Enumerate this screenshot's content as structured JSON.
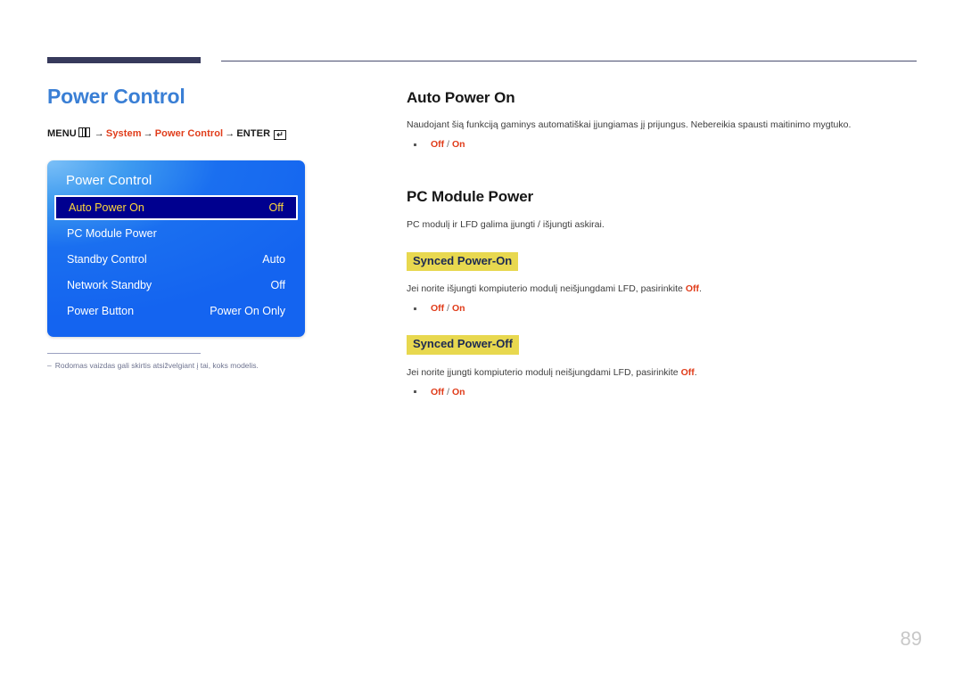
{
  "document": {
    "page_number": "89"
  },
  "left": {
    "title": "Power Control",
    "menu_path": {
      "menu_label": "MENU",
      "menu_icon": "menu-grid-icon",
      "arrow": "→",
      "step1": "System",
      "step2": "Power Control",
      "enter_label": "ENTER",
      "enter_icon": "↵"
    },
    "osd": {
      "title": "Power Control",
      "rows": [
        {
          "label": "Auto Power On",
          "value": "Off",
          "selected": true
        },
        {
          "label": "PC Module Power",
          "value": "",
          "selected": false
        },
        {
          "label": "Standby Control",
          "value": "Auto",
          "selected": false
        },
        {
          "label": "Network Standby",
          "value": "Off",
          "selected": false
        },
        {
          "label": "Power Button",
          "value": "Power On Only",
          "selected": false
        }
      ]
    },
    "footnote": {
      "dash": "–",
      "text": "Rodomas vaizdas gali skirtis atsižvelgiant į tai, koks modelis."
    }
  },
  "right": {
    "section1": {
      "heading": "Auto Power On",
      "description": "Naudojant šią funkciją gaminys automatiškai įjungiamas jį prijungus. Nebereikia spausti maitinimo mygtuko.",
      "option_off": "Off",
      "option_sep": "/",
      "option_on": "On"
    },
    "section2": {
      "heading": "PC Module Power",
      "description": "PC modulį ir LFD galima įjungti / išjungti askirai.",
      "sub1": {
        "heading": "Synced Power-On",
        "description_pre": "Jei norite išjungti kompiuterio modulį neišjungdami LFD, pasirinkite ",
        "description_accent": "Off",
        "description_post": ".",
        "option_off": "Off",
        "option_sep": "/",
        "option_on": "On"
      },
      "sub2": {
        "heading": "Synced Power-Off",
        "description_pre": "Jei norite įjungti kompiuterio modulį neišjungdami LFD, pasirinkite ",
        "description_accent": "Off",
        "description_post": ".",
        "option_off": "Off",
        "option_sep": "/",
        "option_on": "On"
      }
    }
  },
  "colors": {
    "page_title_blue": "#3a7fd5",
    "accent_red": "#e03c1a",
    "highlight_yellow": "#e8d84f",
    "highlight_text_navy": "#1d2a52",
    "rule_navy": "#373a5c",
    "osd_blue": "#1464f0",
    "osd_selected_navy": "#00008f",
    "osd_selected_text": "#ffd83a"
  }
}
